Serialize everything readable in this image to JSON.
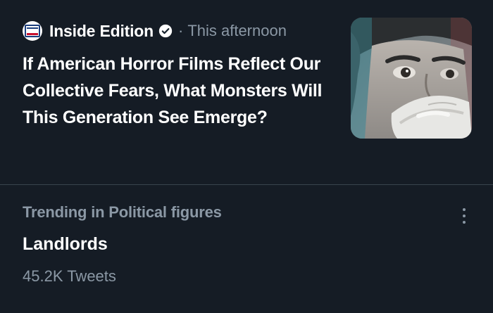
{
  "news": {
    "source_name": "Inside Edition",
    "logo_text": "INSIDE EDITION",
    "separator": "·",
    "timestamp": "This afternoon",
    "headline": "If American Horror Films Reflect Our Collective Fears, What Monsters Will This Generation See Emerge?",
    "thumbnail_icon": "masked-face-photo",
    "verified_icon": "verified-badge-icon"
  },
  "trend": {
    "context": "Trending in Political figures",
    "name": "Landlords",
    "count": "45.2K Tweets",
    "more_icon": "more-vertical-icon"
  },
  "colors": {
    "background": "#151c25",
    "divider": "#38444d",
    "primary_text": "#ffffff",
    "secondary_text": "#8b98a5"
  }
}
